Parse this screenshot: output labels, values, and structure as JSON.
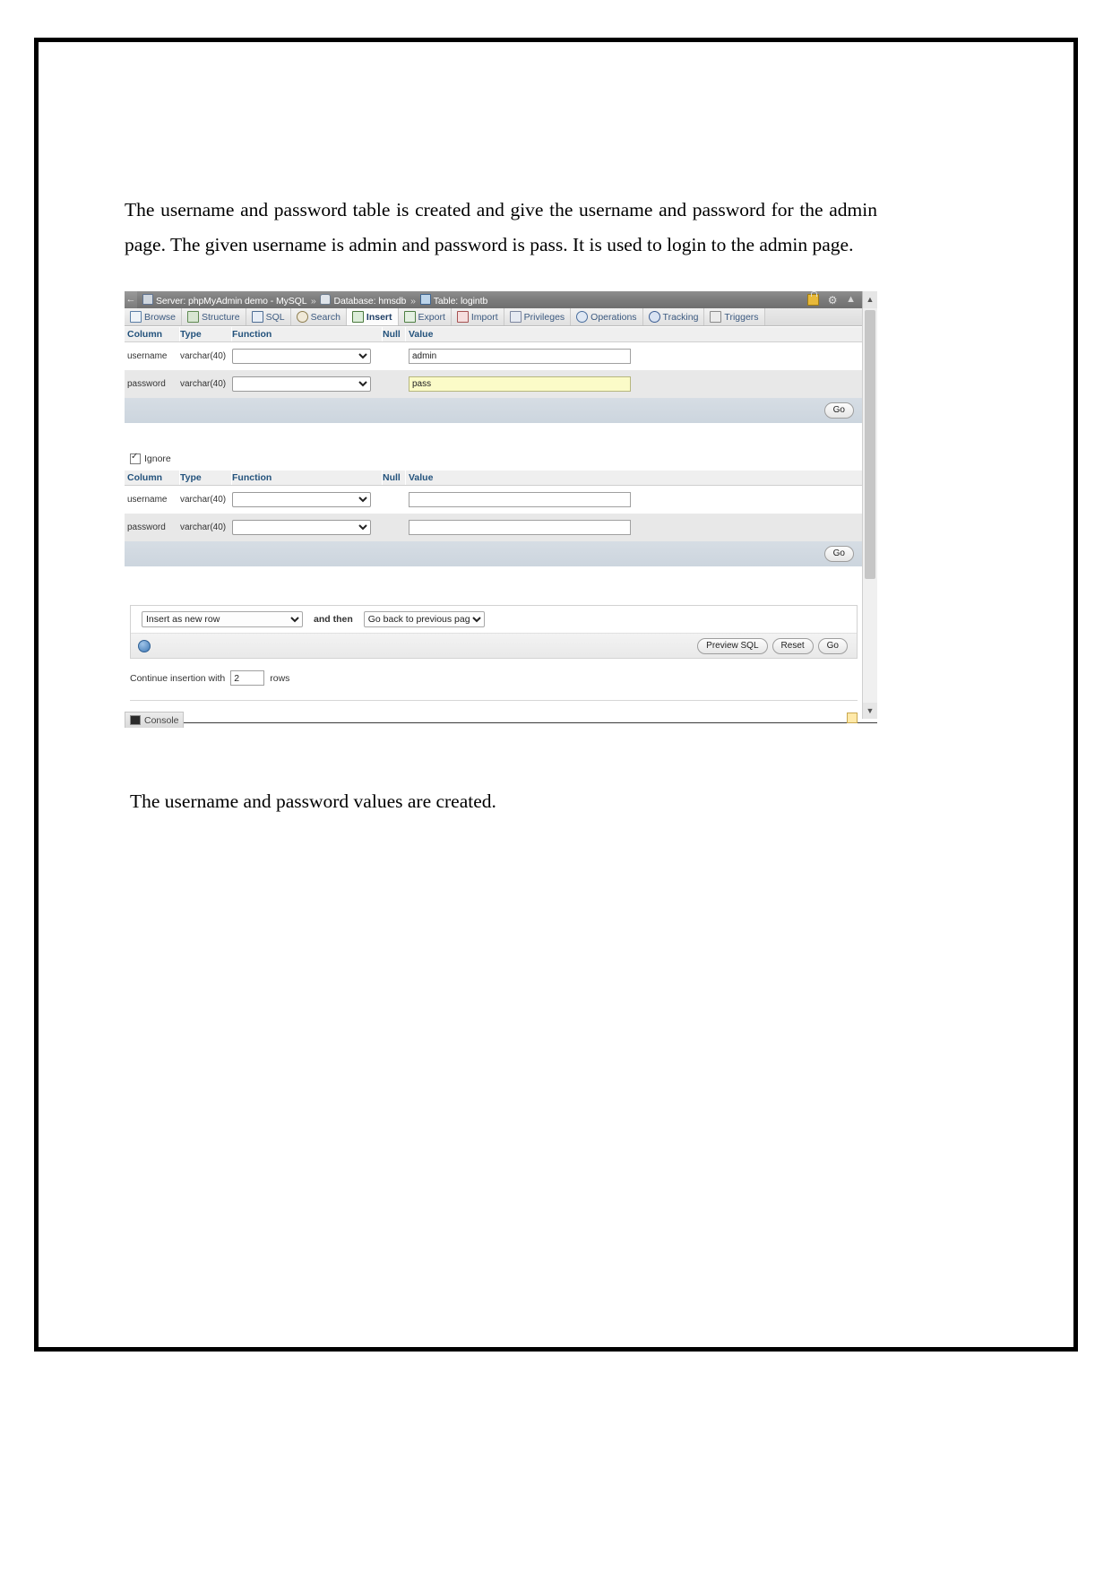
{
  "document": {
    "intro_paragraph": "The username and password table is created and give the username and password for the admin page. The given username is admin and password is pass. It is used to login to the admin page.",
    "closing_paragraph": "The username and password values are created."
  },
  "phpmyadmin": {
    "breadcrumb": {
      "server_label": "Server: phpMyAdmin demo - MySQL",
      "sep1": "»",
      "database_label": "Database: hmsdb",
      "sep2": "»",
      "table_label": "Table: logintb",
      "collapse_icon": "collapse-icon",
      "lock_icon": "lock-icon",
      "gear_icon": "gear-icon",
      "chevron_icon": "chevron-up-icon"
    },
    "tabs": [
      {
        "label": "Browse",
        "icon": "browse-icon",
        "active": false
      },
      {
        "label": "Structure",
        "icon": "structure-icon",
        "active": false
      },
      {
        "label": "SQL",
        "icon": "sql-icon",
        "active": false
      },
      {
        "label": "Search",
        "icon": "search-icon",
        "active": false
      },
      {
        "label": "Insert",
        "icon": "insert-icon",
        "active": true
      },
      {
        "label": "Export",
        "icon": "export-icon",
        "active": false
      },
      {
        "label": "Import",
        "icon": "import-icon",
        "active": false
      },
      {
        "label": "Privileges",
        "icon": "privileges-icon",
        "active": false
      },
      {
        "label": "Operations",
        "icon": "operations-icon",
        "active": false
      },
      {
        "label": "Tracking",
        "icon": "tracking-icon",
        "active": false
      },
      {
        "label": "Triggers",
        "icon": "triggers-icon",
        "active": false
      }
    ],
    "table_headers": {
      "column": "Column",
      "type": "Type",
      "function": "Function",
      "null": "Null",
      "value": "Value"
    },
    "insert_block_1": {
      "rows": [
        {
          "column": "username",
          "type": "varchar(40)",
          "function_value": "",
          "value": "admin",
          "focused": false
        },
        {
          "column": "password",
          "type": "varchar(40)",
          "function_value": "",
          "value": "pass",
          "focused": true
        }
      ],
      "go_label": "Go"
    },
    "ignore_checkbox": {
      "label": "Ignore",
      "checked": true
    },
    "insert_block_2": {
      "rows": [
        {
          "column": "username",
          "type": "varchar(40)",
          "function_value": "",
          "value": "",
          "focused": false
        },
        {
          "column": "password",
          "type": "varchar(40)",
          "function_value": "",
          "value": "",
          "focused": false
        }
      ],
      "go_label": "Go"
    },
    "options": {
      "insert_mode": "Insert as new row",
      "and_then_label": "and then",
      "after_action": "Go back to previous page",
      "preview_sql_label": "Preview SQL",
      "reset_label": "Reset",
      "go_label": "Go",
      "globe_icon": "globe-icon"
    },
    "continue_insertion": {
      "prefix_label": "Continue insertion with",
      "rows_value": "2",
      "suffix_label": "rows"
    },
    "console": {
      "label": "Console",
      "icon": "console-icon"
    }
  },
  "colors": {
    "topbar": "#7d7d7d",
    "tab_text": "#3c5a80",
    "header_text": "#23527c",
    "focused_input_bg": "#fbfbc8",
    "footer_gradient": "#ccd5de"
  }
}
